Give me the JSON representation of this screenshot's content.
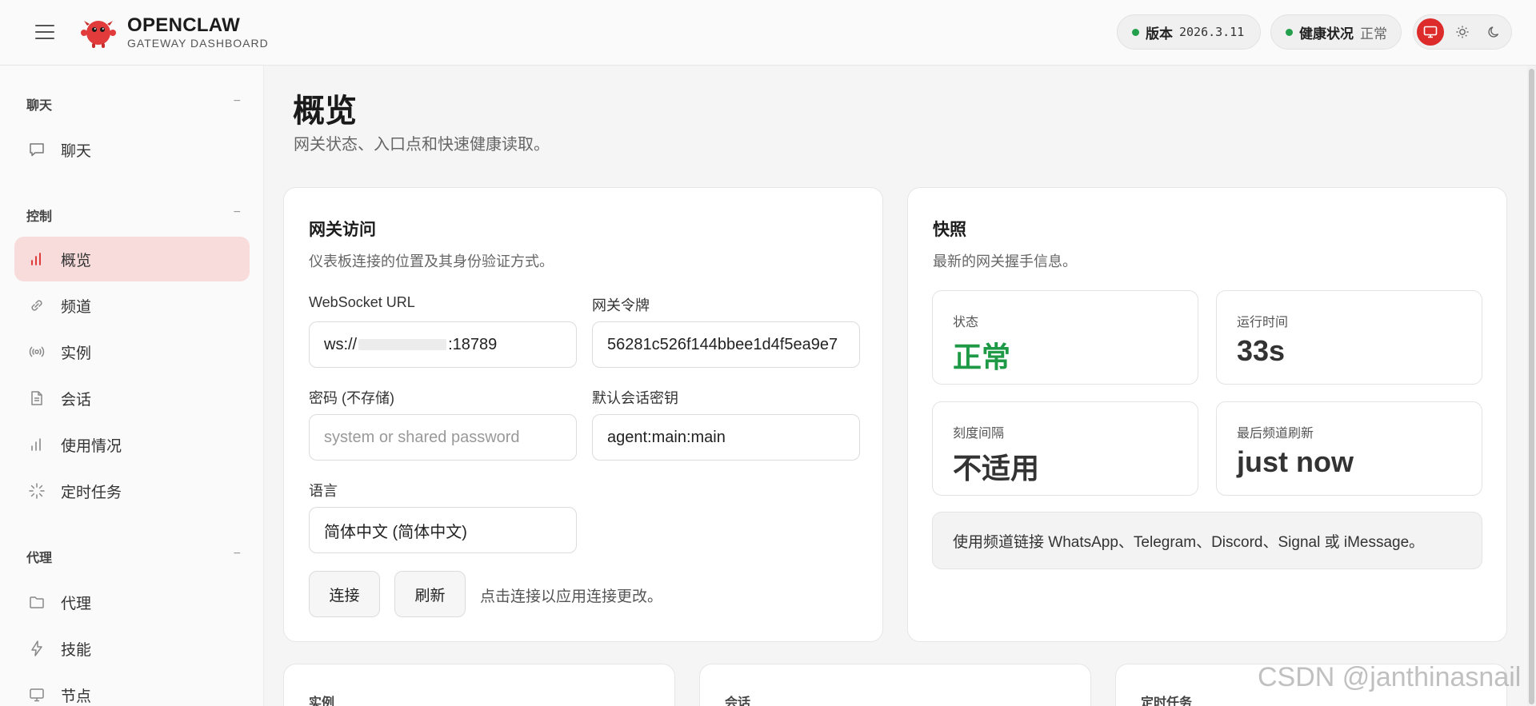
{
  "header": {
    "brand_title": "OPENCLAW",
    "brand_subtitle": "GATEWAY DASHBOARD",
    "version_label": "版本",
    "version_value": "2026.3.11",
    "health_label": "健康状况",
    "health_value": "正常",
    "theme_modes": [
      "monitor-icon",
      "sun-icon",
      "moon-icon"
    ],
    "active_theme": "system"
  },
  "sidebar": {
    "groups": [
      {
        "label": "聊天",
        "collapse": "−",
        "items": [
          {
            "label": "聊天",
            "icon": "chat-icon"
          }
        ]
      },
      {
        "label": "控制",
        "collapse": "−",
        "items": [
          {
            "label": "概览",
            "icon": "bar-chart-icon",
            "active": true
          },
          {
            "label": "频道",
            "icon": "link-icon"
          },
          {
            "label": "实例",
            "icon": "broadcast-icon"
          },
          {
            "label": "会话",
            "icon": "document-icon"
          },
          {
            "label": "使用情况",
            "icon": "bar-chart-icon"
          },
          {
            "label": "定时任务",
            "icon": "spinner-icon"
          }
        ]
      },
      {
        "label": "代理",
        "collapse": "−",
        "items": [
          {
            "label": "代理",
            "icon": "folder-icon"
          },
          {
            "label": "技能",
            "icon": "lightning-icon"
          },
          {
            "label": "节点",
            "icon": "monitor-icon"
          }
        ]
      }
    ]
  },
  "main": {
    "title": "概览",
    "subtitle": "网关状态、入口点和快速健康读取。",
    "access_card": {
      "title": "网关访问",
      "subtitle": "仪表板连接的位置及其身份验证方式。",
      "ws_label": "WebSocket URL",
      "ws_prefix": "ws://",
      "ws_suffix": ":18789",
      "token_label": "网关令牌",
      "token_value": "56281c526f144bbee1d4f5ea9e7",
      "password_label": "密码 (不存储)",
      "password_placeholder": "system or shared password",
      "session_key_label": "默认会话密钥",
      "session_key_value": "agent:main:main",
      "language_label": "语言",
      "language_value": "简体中文 (简体中文)",
      "connect_button": "连接",
      "refresh_button": "刷新",
      "hint": "点击连接以应用连接更改。"
    },
    "snapshot_card": {
      "title": "快照",
      "subtitle": "最新的网关握手信息。",
      "stats": [
        {
          "label": "状态",
          "value": "正常"
        },
        {
          "label": "运行时间",
          "value": "33s"
        },
        {
          "label": "刻度间隔",
          "value": "不适用"
        },
        {
          "label": "最后频道刷新",
          "value": "just now"
        }
      ],
      "callout": "使用频道链接 WhatsApp、Telegram、Discord、Signal 或 iMessage。"
    },
    "bottom_cards": [
      "实例",
      "会话",
      "定时任务"
    ]
  },
  "watermark": "CSDN @janthinasnail",
  "colors": {
    "accent": "#dd2a2a",
    "ok": "#1e9a47",
    "active_nav_bg": "#f8dcdc"
  }
}
